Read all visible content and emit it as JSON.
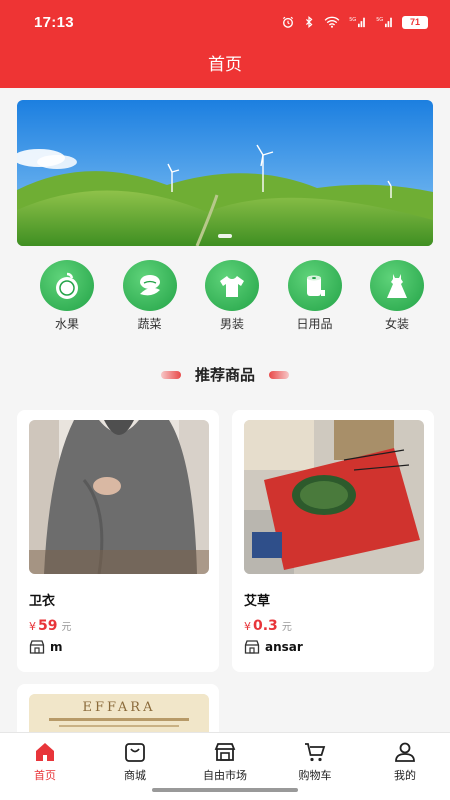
{
  "status_bar": {
    "time": "17:13",
    "battery": "71"
  },
  "header": {
    "title": "首页"
  },
  "categories": [
    {
      "label": "水果",
      "icon": "fruit-icon"
    },
    {
      "label": "蔬菜",
      "icon": "vegetable-icon"
    },
    {
      "label": "男装",
      "icon": "shirt-icon"
    },
    {
      "label": "日用品",
      "icon": "tissue-roll-icon"
    },
    {
      "label": "女装",
      "icon": "dress-icon"
    }
  ],
  "recommend": {
    "title": "推荐商品"
  },
  "products": [
    {
      "name": "卫衣",
      "currency": "¥",
      "price": "59",
      "unit": "元",
      "shop": "m"
    },
    {
      "name": "艾草",
      "currency": "¥",
      "price": "0.3",
      "unit": "元",
      "shop": "ansar"
    },
    {
      "name": "",
      "image_text": "EFFARA"
    }
  ],
  "tabbar": [
    {
      "label": "首页",
      "icon": "home-icon",
      "active": true
    },
    {
      "label": "商城",
      "icon": "shopping-bag-icon"
    },
    {
      "label": "自由市场",
      "icon": "market-icon"
    },
    {
      "label": "购物车",
      "icon": "cart-icon"
    },
    {
      "label": "我的",
      "icon": "user-icon"
    }
  ],
  "colors": {
    "brand": "#ee3434",
    "category_green": "#23a347",
    "price": "#e8353a"
  }
}
